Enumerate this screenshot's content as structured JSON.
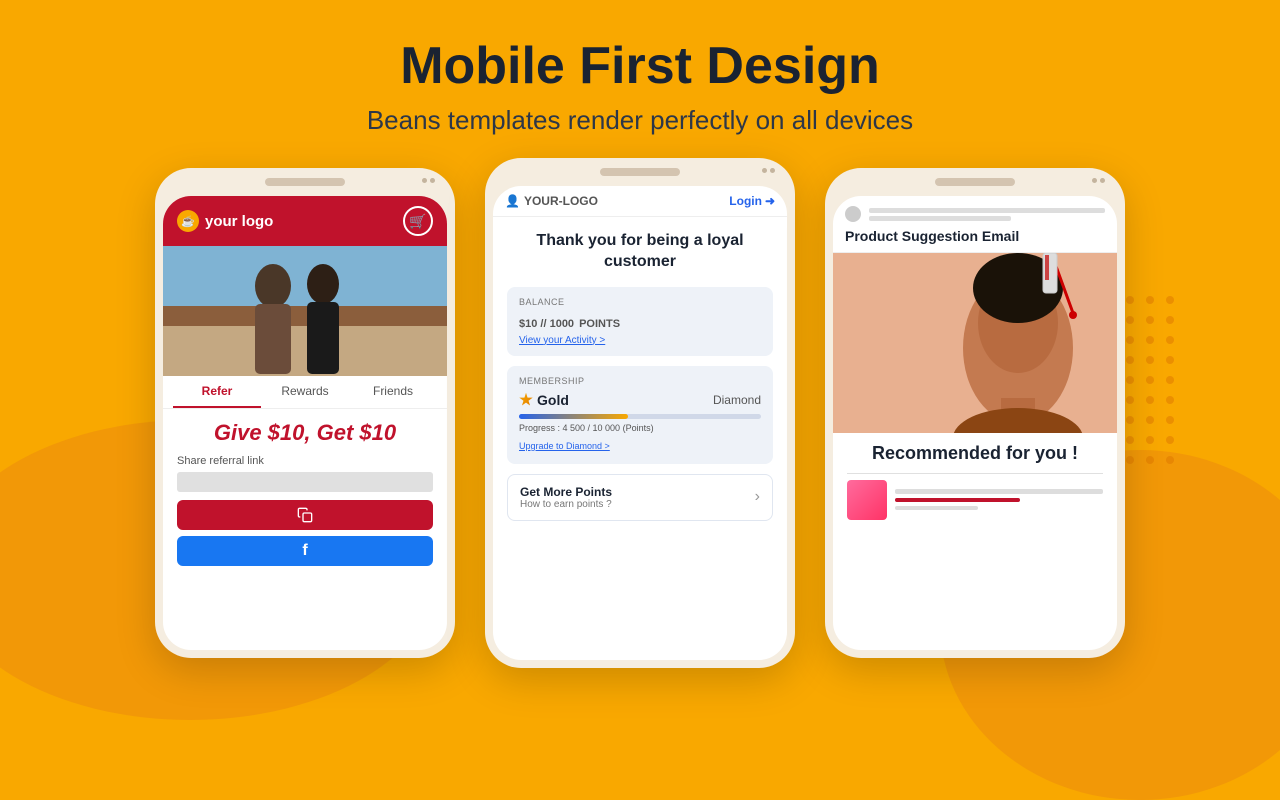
{
  "header": {
    "title": "Mobile First Design",
    "subtitle": "Beans templates render perfectly on all devices"
  },
  "phone1": {
    "logo_text": "your logo",
    "tabs": [
      "Refer",
      "Rewards",
      "Friends"
    ],
    "active_tab": "Refer",
    "promo_text": "Give $10, Get $10",
    "share_label": "Share referral link",
    "copy_button": "copy",
    "facebook_button": "f"
  },
  "phone2": {
    "logo_text": "YOUR-LOGO",
    "login_text": "Login",
    "thank_you_text": "Thank you for being a loyal customer",
    "balance_label": "BALANCE",
    "balance_value": "$10 // 1000",
    "balance_points": "POINTS",
    "view_activity": "View your Activity >",
    "membership_label": "MEMBERSHIP",
    "tier_current": "Gold",
    "tier_next": "Diamond",
    "progress_text": "Progress : 4 500 / 10 000 (Points)",
    "upgrade_link": "Upgrade to Diamond >",
    "get_points_title": "Get More Points",
    "get_points_subtitle": "How to earn points ?"
  },
  "phone3": {
    "product_suggestion_title": "Product Suggestion Email",
    "recommended_text": "Recommended for you !"
  },
  "colors": {
    "background": "#F9A800",
    "crimson": "#c0122c",
    "blue": "#2563eb",
    "facebook_blue": "#1877F2",
    "dark": "#1a2332"
  }
}
